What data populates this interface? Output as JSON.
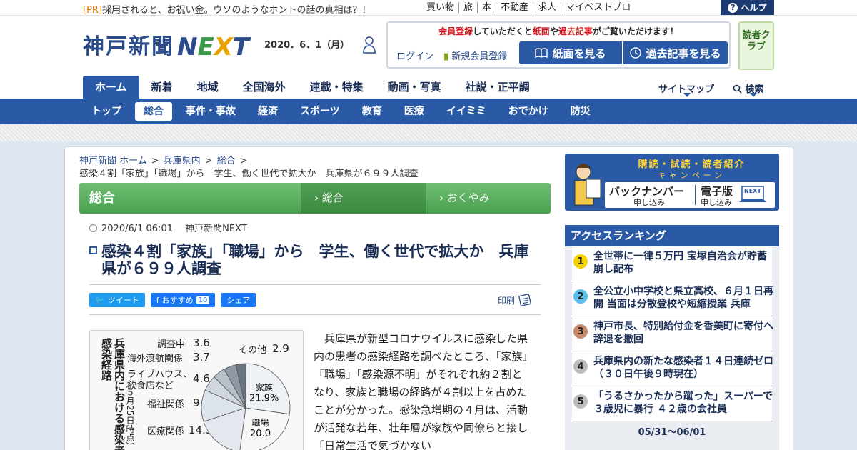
{
  "pr": {
    "tag": "[PR]",
    "text": "採用されると、お祝い金。ウソのようなホントの話の真相は？！"
  },
  "util_links": [
    "買い物",
    "旅",
    "本",
    "不動産",
    "求人",
    "マイベストプロ"
  ],
  "help_label": "ヘルプ",
  "logo": {
    "jp": "神戸新聞",
    "en_n": "N",
    "en_e": "E",
    "en_x": "X",
    "en_t": "T"
  },
  "date": "2020．6．1（月）",
  "member": {
    "msg_pre": "会員登録",
    "msg_mid1": "していただくと",
    "msg_red2": "紙面",
    "msg_mid2": "や",
    "msg_red3": "過去記事",
    "msg_post": "がご覧いただけます！",
    "login": "ログイン",
    "signup": "新規会員登録",
    "paper_btn": "紙面を見る",
    "past_btn": "過去記事を見る"
  },
  "reader_club": "読者クラブ",
  "mainnav": [
    "ホーム",
    "新着",
    "地域",
    "全国海外",
    "連載・特集",
    "動画・写真",
    "社説・正平調"
  ],
  "sitemap": "サイトマップ",
  "search": "検索",
  "subnav": [
    "トップ",
    "総合",
    "事件・事故",
    "経済",
    "スポーツ",
    "教育",
    "医療",
    "イイミミ",
    "おでかけ",
    "防災"
  ],
  "breadcrumb": [
    "神戸新聞 ホーム",
    "兵庫県内",
    "総合"
  ],
  "breadcrumb_sep": ">",
  "breadcrumb_current": "感染４割「家族」「職場」から　学生、働く世代で拡大か　兵庫県が６９９人調査",
  "category": {
    "main": "総合",
    "tab1": "総合",
    "tab2": "おくやみ"
  },
  "article": {
    "datetime": "2020/6/1 06:01",
    "source": "神戸新聞NEXT",
    "headline": "感染４割「家族」「職場」から　学生、働く世代で拡大か　兵庫県が６９９人調査",
    "body": "兵庫県が新型コロナウイルスに感染した県内の患者の感染経路を調べたところ、「家族」「職場」「感染源不明」がそれぞれ約２割となり、家族と職場の経路が４割以上を占めたことが分かった。感染急増期の４月は、活動が活発な若年、壮年層が家族や同僚らと接し「日常生活で気づかない"
  },
  "social": {
    "tweet": "ツイート",
    "fb_label": "おすすめ",
    "fb_count": "10",
    "share": "シェア",
    "print": "印刷"
  },
  "figure": {
    "title": "兵庫県内における感染者の感染経路",
    "subtitle": "（５月25日時点）",
    "labels": [
      "調査中",
      "海外渡航関係",
      "ライブハウス、",
      "飲食店など",
      "福祉関係",
      "医療関係",
      "その他",
      "家族",
      "職場"
    ],
    "values": [
      "3.6",
      "3.7",
      "4.6",
      "9.3",
      "14.3",
      "2.9",
      "21.9%",
      "20.0"
    ]
  },
  "chart_data": {
    "type": "pie",
    "title": "兵庫県内における感染者の感染経路",
    "subtitle": "（５月25日時点）",
    "slices": [
      {
        "label": "家族",
        "value": 21.9
      },
      {
        "label": "職場",
        "value": 20.0
      },
      {
        "label": "医療関係",
        "value": 14.3
      },
      {
        "label": "福祉関係",
        "value": 9.3
      },
      {
        "label": "ライブハウス、飲食店など",
        "value": 4.6
      },
      {
        "label": "海外渡航関係",
        "value": 3.7
      },
      {
        "label": "調査中",
        "value": 3.6
      },
      {
        "label": "その他",
        "value": 2.9
      }
    ]
  },
  "campaign": {
    "top": "購読・試読・読者紹介",
    "mid": "キャンペーン",
    "backnumber": "バックナンバー",
    "backnumber_sub": "申し込み",
    "digital": "電子版",
    "digital_sub": "申し込み",
    "next_tag": "NEXT"
  },
  "ranking": {
    "title": "アクセスランキング",
    "items": [
      {
        "num": "1",
        "text": "全世帯に一律５万円 宝塚自治会が貯蓄崩し配布",
        "color": "#f5d300"
      },
      {
        "num": "2",
        "text": "全公立小中学校と県立高校、６月１日再開 当面は分散登校や短縮授業 兵庫",
        "color": "#5bc0eb"
      },
      {
        "num": "3",
        "text": "神戸市長、特別給付金を香美町に寄付へ 辞退を撤回",
        "color": "#c98a6b"
      },
      {
        "num": "4",
        "text": "兵庫県内の新たな感染者１４日連続ゼロ（３０日午後９時現在）",
        "color": "#bdbdbd"
      },
      {
        "num": "5",
        "text": "「うるさかったから蹴った」スーパーで３歳児に暴行 ４２歳の会社員",
        "color": "#bdbdbd"
      }
    ],
    "range": "05/31～06/01"
  }
}
